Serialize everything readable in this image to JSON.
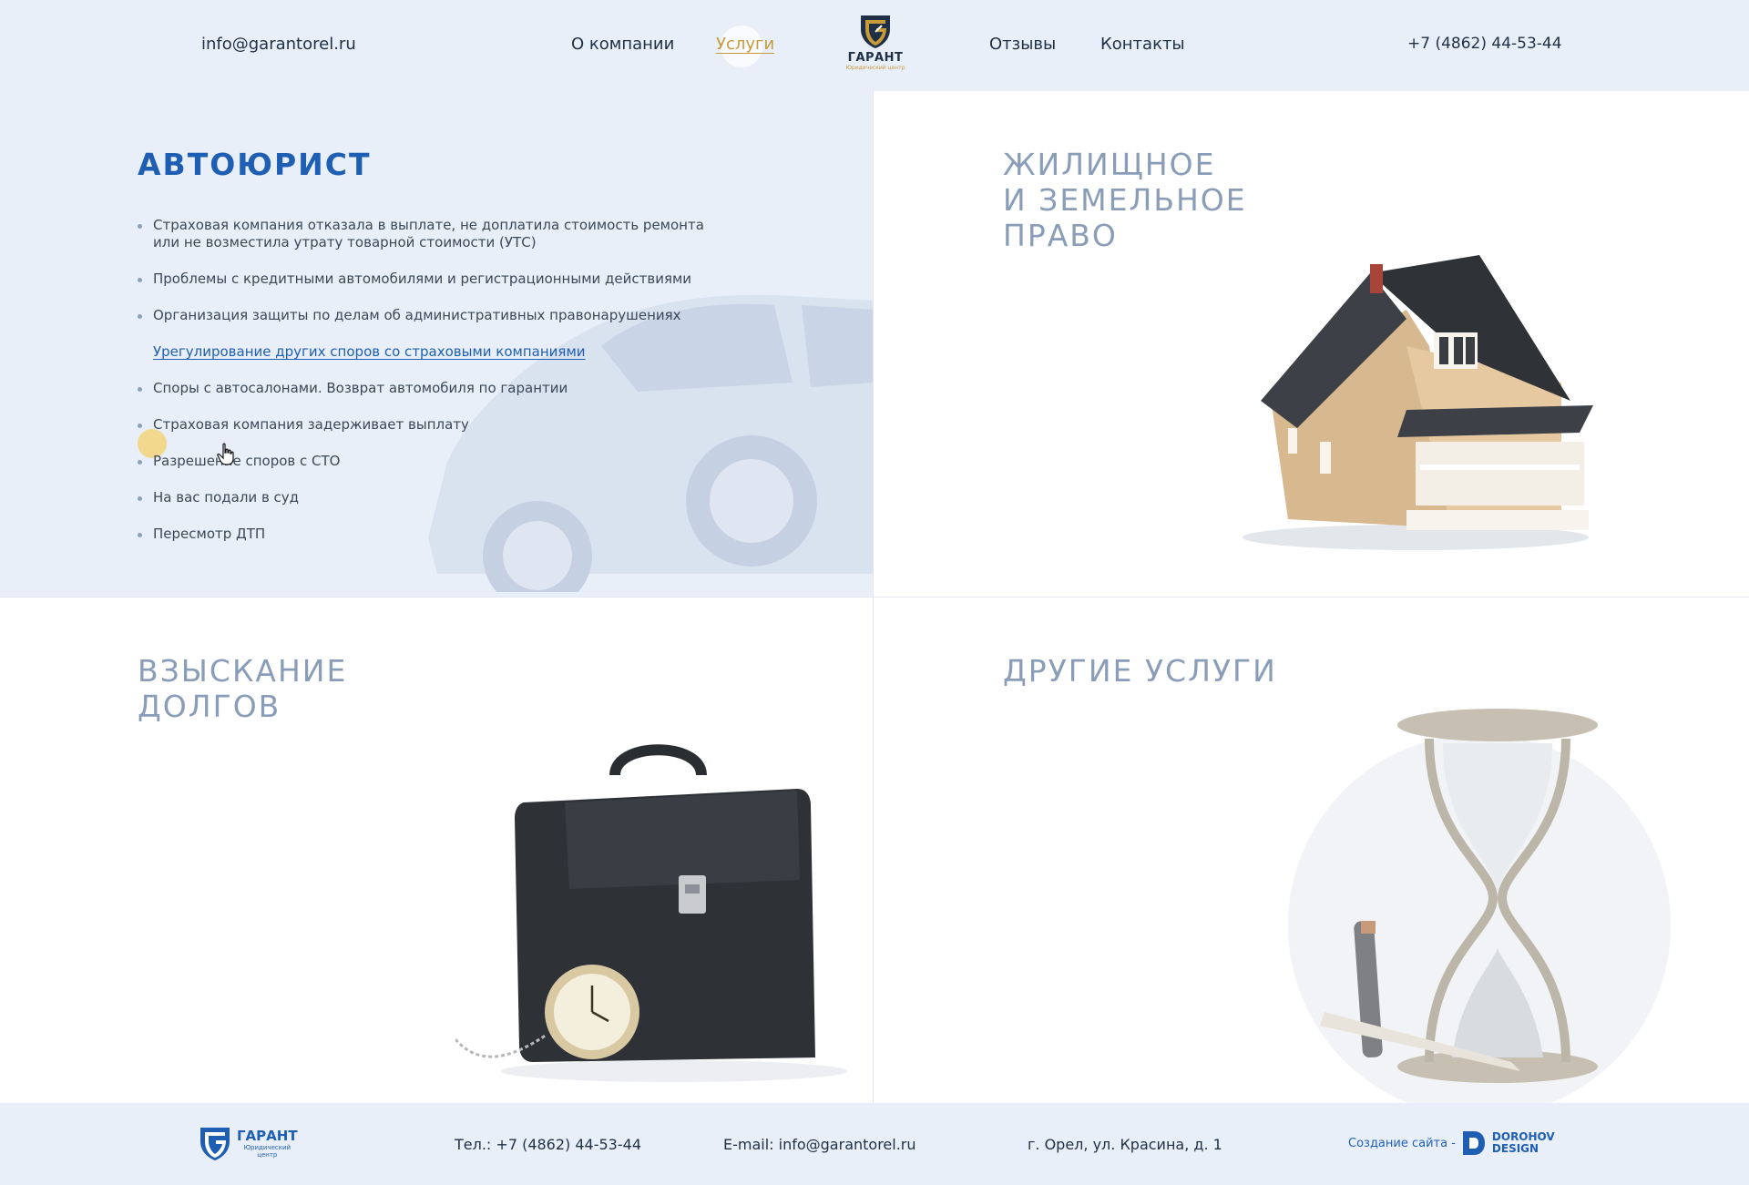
{
  "header": {
    "email": "info@garantorel.ru",
    "nav": {
      "about": "О компании",
      "services": "Услуги",
      "reviews": "Отзывы",
      "contacts": "Контакты"
    },
    "logo_name": "ГАРАНТ",
    "logo_sub": "Юридический центр",
    "phone": "+7 (4862) 44-53-44"
  },
  "panels": {
    "auto": {
      "title": "АВТОЮРИСТ",
      "items": [
        "Страховая компания отказала в выплате, не доплатила стоимость ремонта или не возместила утрату товарной стоимости (УТС)",
        "Проблемы с кредитными автомобилями и регистрационными действиями",
        "Организация защиты по делам об административных правонарушениях",
        "Урегулирование других споров со страховыми компаниями",
        "Споры с автосалонами. Возврат автомобиля по гарантии",
        "Страховая компания задерживает выплату",
        "Разрешение споров с СТО",
        "На вас подали в суд",
        "Пересмотр ДТП"
      ],
      "active_item_index": 3
    },
    "housing": {
      "title": "ЖИЛИЩНОЕ\nИ ЗЕМЕЛЬНОЕ\nПРАВО"
    },
    "debts": {
      "title": "ВЗЫСКАНИЕ\nДОЛГОВ"
    },
    "other": {
      "title": "ДРУГИЕ УСЛУГИ"
    }
  },
  "footer": {
    "logo_name": "ГАРАНТ",
    "logo_sub": "Юридический центр",
    "phone": "Тел.: +7 (4862) 44-53-44",
    "email": "E-mail: info@garantorel.ru",
    "address": "г. Орел, ул. Красина, д. 1",
    "credit_label": "Создание сайта -",
    "credit_name": "DOROHOV\nDESIGN"
  },
  "colors": {
    "accent_blue": "#1f5fb3",
    "accent_gold": "#c79a3a",
    "header_bg": "#e9eff9",
    "muted_title": "#8a9db8"
  },
  "icons": {
    "logo": "shield-logo-icon",
    "cursor": "hand-pointer-icon"
  }
}
